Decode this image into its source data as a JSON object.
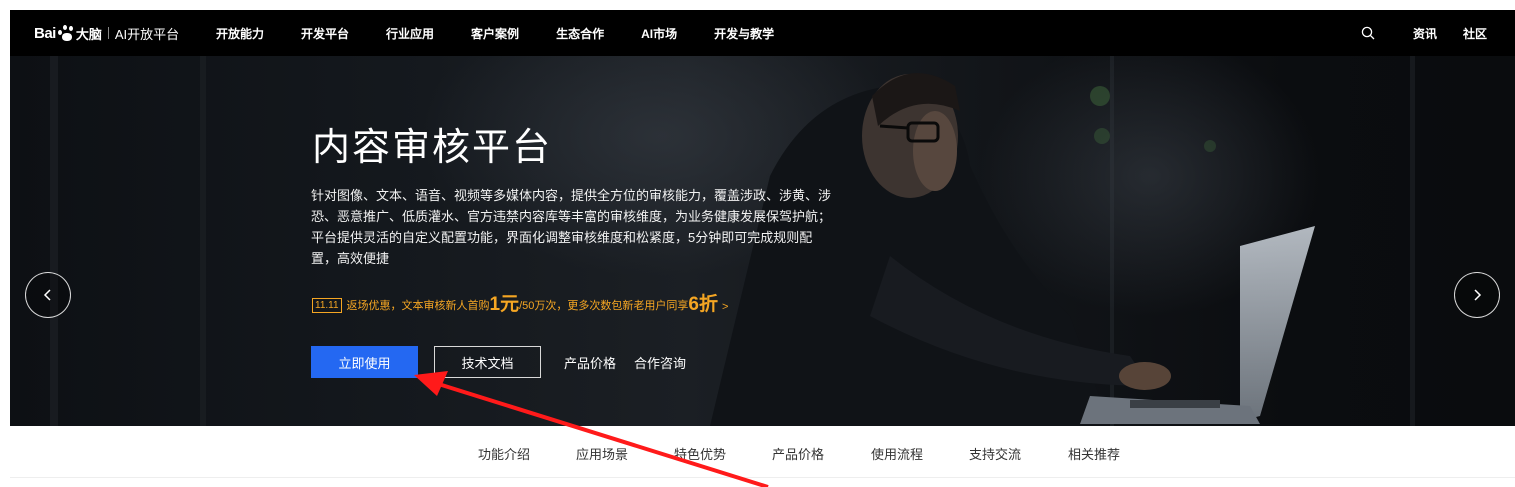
{
  "header": {
    "logo": {
      "brand": "Bai",
      "brand_suffix": "大脑",
      "platform": "AI开放平台"
    },
    "nav_items": [
      "开放能力",
      "开发平台",
      "行业应用",
      "客户案例",
      "生态合作",
      "AI市场",
      "开发与教学"
    ],
    "right_links": [
      "资讯",
      "社区"
    ],
    "search_icon": "search-icon"
  },
  "hero": {
    "title": "内容审核平台",
    "description": "针对图像、文本、语音、视频等多媒体内容，提供全方位的审核能力，覆盖涉政、涉黄、涉恐、恶意推广、低质灌水、官方违禁内容库等丰富的审核维度，为业务健康发展保驾护航；平台提供灵活的自定义配置功能，界面化调整审核维度和松紧度，5分钟即可完成规则配置，高效便捷",
    "promo": {
      "tag": "11.11",
      "text_a": "返场优惠，文本审核新人首购",
      "price": "1元",
      "text_b": "/50万次，更多次数包新老用户同享",
      "discount": "6折",
      "more": ">"
    },
    "primary_button": "立即使用",
    "secondary_button": "技术文档",
    "links": [
      "产品价格",
      "合作咨询"
    ],
    "prev_icon": "chevron-left-icon",
    "next_icon": "chevron-right-icon"
  },
  "subnav": {
    "items": [
      "功能介绍",
      "应用场景",
      "特色优势",
      "产品价格",
      "使用流程",
      "支持交流",
      "相关推荐"
    ]
  },
  "colors": {
    "nav_bg": "#000000",
    "primary": "#2468f2",
    "promo": "#f5a623",
    "annotation": "#ff1a1a"
  }
}
